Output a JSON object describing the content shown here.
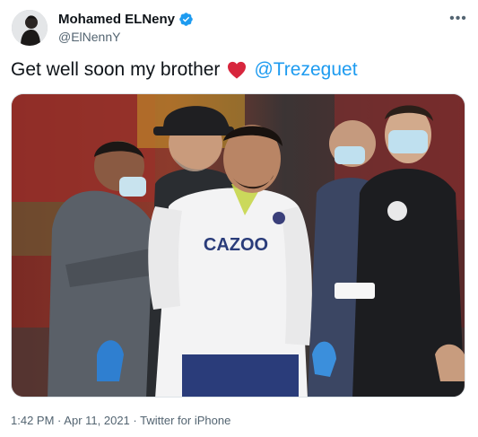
{
  "author": {
    "display_name": "Mohamed ELNeny",
    "handle": "@ElNennY",
    "verified": true
  },
  "tweet": {
    "text_before": "Get well soon my brother",
    "emoji": "red-heart-icon",
    "mention": "@Trezeguet"
  },
  "media": {
    "jersey_text": "CAZOO"
  },
  "meta": {
    "time": "1:42 PM",
    "separator": "·",
    "date": "Apr 11, 2021",
    "source": "Twitter for iPhone"
  },
  "colors": {
    "accent": "#1d9bf0",
    "heart": "#d7263d",
    "secondary_text": "#536471"
  }
}
